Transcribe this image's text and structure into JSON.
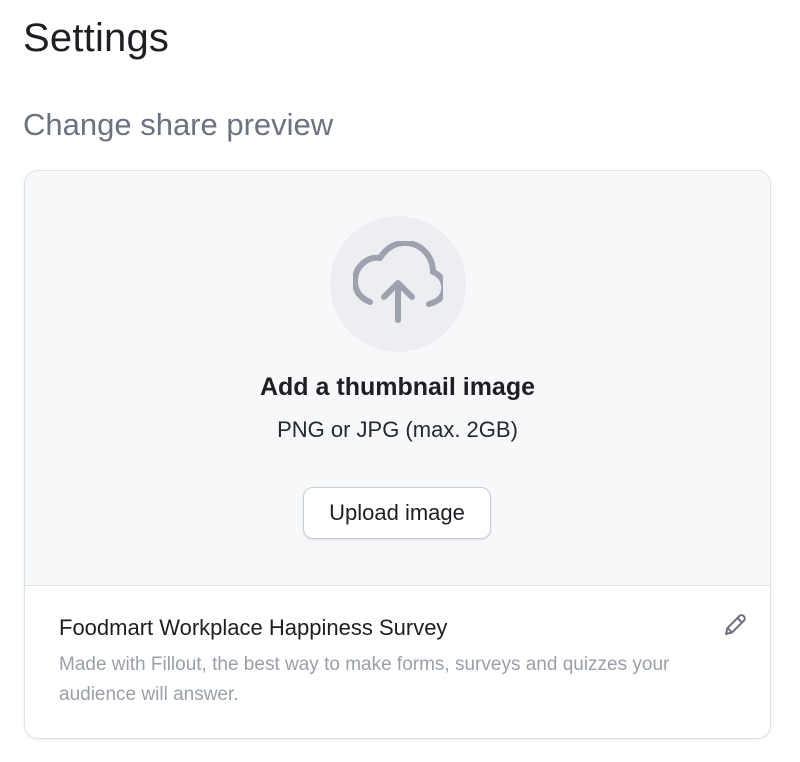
{
  "page": {
    "title": "Settings"
  },
  "share_preview": {
    "section_title": "Change share preview",
    "upload": {
      "icon": "cloud-upload-icon",
      "heading": "Add a thumbnail image",
      "hint": "PNG or JPG (max. 2GB)",
      "button_label": "Upload image"
    },
    "preview": {
      "title": "Foodmart Workplace Happiness Survey",
      "description": "Made with Fillout, the best way to make forms, surveys and quizzes your audience will answer.",
      "edit_icon": "pencil-icon"
    }
  },
  "colors": {
    "text_primary": "#1d1f24",
    "text_secondary": "#6b7280",
    "text_muted": "#9aa0a9",
    "upload_background": "#f7f8fa",
    "icon_circle": "#eceef1",
    "icon_stroke": "#9ca3af",
    "border": "#dfe2e7"
  }
}
